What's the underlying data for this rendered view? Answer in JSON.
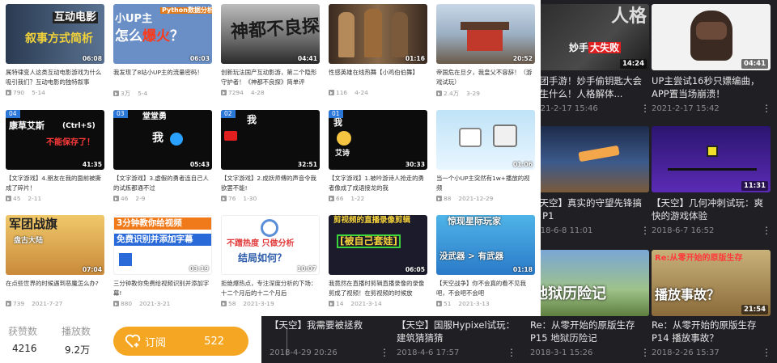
{
  "light_videos": [
    {
      "title": "属特律变人这类互动电影游戏为什么吸引我们？互动电影的独特叙事",
      "views": "790",
      "date": "5-14",
      "dur": "06:08",
      "thumb": "互动电影 叙事方式简析"
    },
    {
      "title": "我发现了8站小UP主的流量密码！",
      "views": "3万",
      "date": "5-4",
      "dur": "06:03",
      "thumb": "小UP主 怎么爆火？"
    },
    {
      "title": "创新玩法国产互动影游，第二个隐形守护者！《神都不良探》简单评",
      "views": "7294",
      "date": "4-28",
      "dur": "04:41",
      "thumb": "神都不良探"
    },
    {
      "title": "性感英雄在线热舞【小鸡伯伯舞】",
      "views": "116",
      "date": "4-24",
      "dur": "01:16",
      "thumb": ""
    },
    {
      "title": "帝国危在旦夕，我皇父不容辞！（游戏试玩）",
      "views": "2.4万",
      "date": "3-29",
      "dur": "20:52",
      "thumb": ""
    },
    {
      "title": "【文字游戏】4.朋友在我的面前被撕成了碎片！",
      "views": "45",
      "date": "2-11",
      "dur": "41:35",
      "thumb": "康草艾斯 不能保存了！",
      "num": "04"
    },
    {
      "title": "【文字游戏】3.虚假的勇者连自己人的试炼都通不过",
      "views": "46",
      "date": "2-9",
      "dur": "05:43",
      "thumb": "堂堂勇",
      "num": "03"
    },
    {
      "title": "【文字游戏】2.成妖师傅的声音令我欲罢不能!",
      "views": "76",
      "date": "1-30",
      "dur": "32:51",
      "thumb": "我",
      "num": "02"
    },
    {
      "title": "【文字游戏】1.被吟游诗人抢走的勇者像成了成语接龙的我",
      "views": "66",
      "date": "1-22",
      "dur": "30:33",
      "thumb": "我 艾诗",
      "num": "01"
    },
    {
      "title": "当一个小UP主突然有1w+播放的视频",
      "views": "88",
      "date": "2021-12-29",
      "dur": "01:06",
      "thumb": ""
    },
    {
      "title": "在点些世界的时候遇到恶魔怎么办?",
      "views": "739",
      "date": "2021-7-27",
      "dur": "07:04",
      "thumb": "军团战旗 盘古大陆"
    },
    {
      "title": "三分钟教你免费给视频识别并添加字幕!",
      "views": "880",
      "date": "2021-3-21",
      "dur": "03:19",
      "thumb": "3分钟教你给视频 免费识别并添加字幕"
    },
    {
      "title": "拒绝爆热点，专注深度分析的下场：十二个月后的十二个月后",
      "views": "58",
      "date": "2021-3-19",
      "dur": "10:07",
      "thumb": "不蹭热度 只做分析 结局如何？"
    },
    {
      "title": "我竟然在直播时剪辑直播录像的录像剪成了视频！在剪视频的时候放",
      "views": "14",
      "date": "2021-3-14",
      "dur": "06:05",
      "thumb": "剪视频的直播录像剪辑 [被自己套娃]"
    },
    {
      "title": "【天空战争】你不会真的看不见我吧，不会吧不会吧",
      "views": "51",
      "date": "2021-3-13",
      "dur": "01:18",
      "thumb": "惊现星际玩家 没武器 > 有武器"
    }
  ],
  "dark_videos": [
    {
      "title": "跑团手游！妙手偷钥匙大会发生什么！人格解体...",
      "date": "2021-2-17 15:46",
      "dur": "14:24",
      "thumb": "妙手大失败"
    },
    {
      "title": "UP主尝试16秒只嫖编曲，APP置当场崩溃！",
      "date": "2021-2-17 15:42",
      "dur": "04:41",
      "thumb": ""
    },
    {
      "title": "【天空】真实的守望先锋搞笑 P1",
      "date": "2018-6-8 11:01",
      "dur": "",
      "thumb": ""
    },
    {
      "title": "【天空】几何冲刺试玩：爽快的游戏体验 GeometryDash",
      "date": "2018-6-7 16:52",
      "dur": "11:31",
      "thumb": ""
    },
    {
      "title": "【天空】我需要被拯救",
      "date": "2018-4-29 20:26",
      "dur": "",
      "thumb": ""
    },
    {
      "title": "【天空】国服Hypixel试玩：建筑猜猜猜",
      "date": "2018-4-6 17:57",
      "dur": "",
      "thumb": ""
    },
    {
      "title": "Re：从零开始的原版生存 P15 地狱历险记",
      "date": "2018-3-1 15:26",
      "dur": "",
      "thumb": "Re:从零开始的原版生存 地狱历险记"
    },
    {
      "title": "Re：从零开始的原版生存 P14 播放事故？",
      "date": "2018-2-26 15:37",
      "dur": "21:54",
      "thumb": "Re:从零开始的原版生存 P14 播放事故？"
    }
  ],
  "stats": {
    "likes_label": "获赞数",
    "likes_value": "4216",
    "plays_label": "播放数",
    "plays_value": "9.2万",
    "subscribe_label": "订阅",
    "subscribe_count": "522"
  }
}
